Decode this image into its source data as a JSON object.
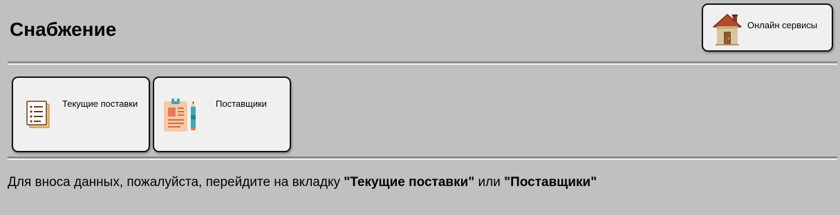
{
  "header": {
    "title": "Снабжение"
  },
  "online_services": {
    "label": "Онлайн сервисы",
    "icon": "house-icon"
  },
  "nav_tiles": [
    {
      "label": "Текущие поставки",
      "icon": "document-list-icon"
    },
    {
      "label": "Поставщики",
      "icon": "clipboard-pencil-icon"
    }
  ],
  "info": {
    "prefix": "Для вноса данных, пожалуйста, перейдите на вкладку ",
    "link1": "\"Текущие поставки\"",
    "middle": " или ",
    "link2": "\"Поставщики\""
  },
  "colors": {
    "background": "#c0c0c0",
    "tile": "#f0f0f0",
    "roof": "#a8452a",
    "house_wall": "#d8c59c"
  }
}
